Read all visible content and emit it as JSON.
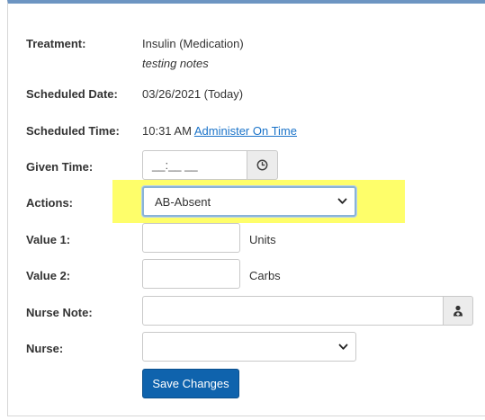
{
  "form": {
    "treatment_label": "Treatment:",
    "treatment_value": "Insulin (Medication)",
    "treatment_notes": "testing notes",
    "scheduled_date_label": "Scheduled Date:",
    "scheduled_date_value": "03/26/2021 (Today)",
    "scheduled_time_label": "Scheduled Time:",
    "scheduled_time_value": "10:31 AM",
    "administer_link": "Administer On Time",
    "given_time_label": "Given Time:",
    "given_time_placeholder": "__:__ __",
    "actions_label": "Actions:",
    "actions_selected": "AB-Absent",
    "value1_label": "Value 1:",
    "value1_unit": "Units",
    "value2_label": "Value 2:",
    "value2_unit": "Carbs",
    "nurse_note_label": "Nurse Note:",
    "nurse_label": "Nurse:",
    "nurse_selected": "",
    "save_label": "Save Changes"
  },
  "icons": {
    "given_time_addon": "clock-icon",
    "nurse_note_addon": "nurse-icon",
    "dropdown": "chevron-down-icon"
  },
  "colors": {
    "highlight": "#fefe6a",
    "primary_button": "#0f63ad",
    "link": "#1a73c9",
    "top_border": "#6d95c2"
  }
}
